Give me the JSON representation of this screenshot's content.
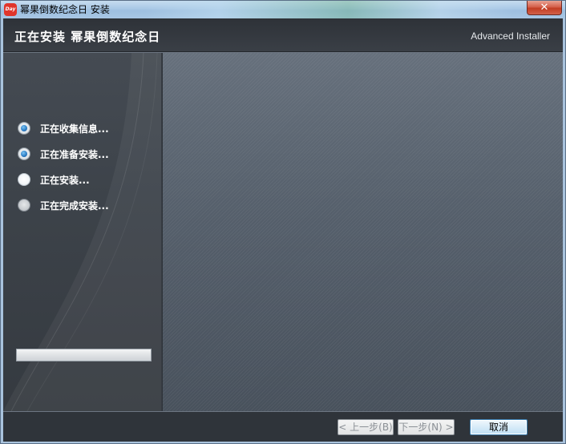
{
  "window": {
    "title": "幂果倒数纪念日 安装",
    "icon_label": "Day",
    "close_glyph": "✕"
  },
  "header": {
    "title": "正在安装 幂果倒数纪念日",
    "brand": "Advanced Installer"
  },
  "steps": [
    {
      "label": "正在收集信息...",
      "state": "done"
    },
    {
      "label": "正在准备安装...",
      "state": "done"
    },
    {
      "label": "正在安装...",
      "state": "current"
    },
    {
      "label": "正在完成安装...",
      "state": "pending"
    }
  ],
  "progress": {
    "value": 0
  },
  "buttons": {
    "back": "< 上一步(B)",
    "next": "下一步(N) >",
    "cancel": "取消"
  },
  "colors": {
    "accent_blue": "#2d7fc7",
    "dialog_bg": "#373c43",
    "content_bg": "#4e5864"
  }
}
